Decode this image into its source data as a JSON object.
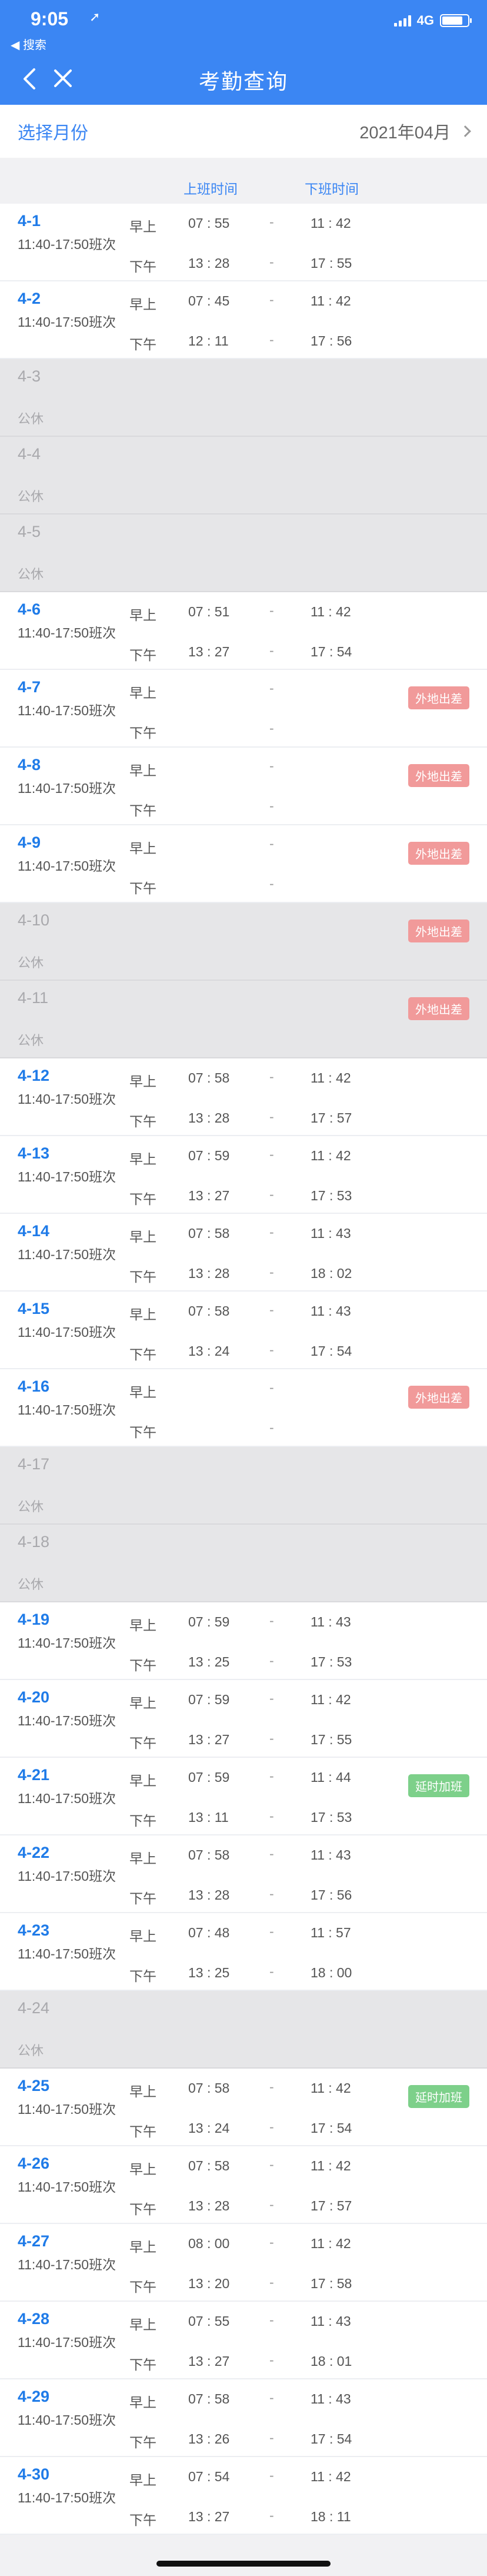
{
  "status_bar": {
    "time": "9:05",
    "back_app": "◀ 搜索",
    "network": "4G",
    "battery_level": 0.8
  },
  "nav": {
    "title": "考勤查询"
  },
  "month_bar": {
    "label": "选择月份",
    "value": "2021年04月"
  },
  "columns": {
    "clock_in": "上班时间",
    "clock_out": "下班时间"
  },
  "labels": {
    "am": "早上",
    "pm": "下午",
    "dash": "-",
    "rest": "公休"
  },
  "colors": {
    "brand": "#3b86f3",
    "business_trip": "#f19a9a",
    "overtime": "#7dd08a"
  },
  "days": [
    {
      "date": "4-1",
      "shift": "11:40-17:50班次",
      "am_in": "07 : 55",
      "am_out": "11 : 42",
      "pm_in": "13 : 28",
      "pm_out": "17 : 55"
    },
    {
      "date": "4-2",
      "shift": "11:40-17:50班次",
      "am_in": "07 : 45",
      "am_out": "11 : 42",
      "pm_in": "12 : 11",
      "pm_out": "17 : 56"
    },
    {
      "date": "4-3",
      "rest": true
    },
    {
      "date": "4-4",
      "rest": true
    },
    {
      "date": "4-5",
      "rest": true
    },
    {
      "date": "4-6",
      "shift": "11:40-17:50班次",
      "am_in": "07 : 51",
      "am_out": "11 : 42",
      "pm_in": "13 : 27",
      "pm_out": "17 : 54"
    },
    {
      "date": "4-7",
      "shift": "11:40-17:50班次",
      "am_in": "",
      "am_out": "",
      "pm_in": "",
      "pm_out": "",
      "tag": "外地出差",
      "tag_type": "trip"
    },
    {
      "date": "4-8",
      "shift": "11:40-17:50班次",
      "am_in": "",
      "am_out": "",
      "pm_in": "",
      "pm_out": "",
      "tag": "外地出差",
      "tag_type": "trip"
    },
    {
      "date": "4-9",
      "shift": "11:40-17:50班次",
      "am_in": "",
      "am_out": "",
      "pm_in": "",
      "pm_out": "",
      "tag": "外地出差",
      "tag_type": "trip"
    },
    {
      "date": "4-10",
      "rest": true,
      "tag": "外地出差",
      "tag_type": "trip"
    },
    {
      "date": "4-11",
      "rest": true,
      "tag": "外地出差",
      "tag_type": "trip"
    },
    {
      "date": "4-12",
      "shift": "11:40-17:50班次",
      "am_in": "07 : 58",
      "am_out": "11 : 42",
      "pm_in": "13 : 28",
      "pm_out": "17 : 57"
    },
    {
      "date": "4-13",
      "shift": "11:40-17:50班次",
      "am_in": "07 : 59",
      "am_out": "11 : 42",
      "pm_in": "13 : 27",
      "pm_out": "17 : 53"
    },
    {
      "date": "4-14",
      "shift": "11:40-17:50班次",
      "am_in": "07 : 58",
      "am_out": "11 : 43",
      "pm_in": "13 : 28",
      "pm_out": "18 : 02"
    },
    {
      "date": "4-15",
      "shift": "11:40-17:50班次",
      "am_in": "07 : 58",
      "am_out": "11 : 43",
      "pm_in": "13 : 24",
      "pm_out": "17 : 54"
    },
    {
      "date": "4-16",
      "shift": "11:40-17:50班次",
      "am_in": "",
      "am_out": "",
      "pm_in": "",
      "pm_out": "",
      "tag": "外地出差",
      "tag_type": "trip"
    },
    {
      "date": "4-17",
      "rest": true
    },
    {
      "date": "4-18",
      "rest": true
    },
    {
      "date": "4-19",
      "shift": "11:40-17:50班次",
      "am_in": "07 : 59",
      "am_out": "11 : 43",
      "pm_in": "13 : 25",
      "pm_out": "17 : 53"
    },
    {
      "date": "4-20",
      "shift": "11:40-17:50班次",
      "am_in": "07 : 59",
      "am_out": "11 : 42",
      "pm_in": "13 : 27",
      "pm_out": "17 : 55"
    },
    {
      "date": "4-21",
      "shift": "11:40-17:50班次",
      "am_in": "07 : 59",
      "am_out": "11 : 44",
      "pm_in": "13 : 11",
      "pm_out": "17 : 53",
      "tag": "延时加班",
      "tag_type": "overtime"
    },
    {
      "date": "4-22",
      "shift": "11:40-17:50班次",
      "am_in": "07 : 58",
      "am_out": "11 : 43",
      "pm_in": "13 : 28",
      "pm_out": "17 : 56"
    },
    {
      "date": "4-23",
      "shift": "11:40-17:50班次",
      "am_in": "07 : 48",
      "am_out": "11 : 57",
      "pm_in": "13 : 25",
      "pm_out": "18 : 00"
    },
    {
      "date": "4-24",
      "rest": true
    },
    {
      "date": "4-25",
      "shift": "11:40-17:50班次",
      "am_in": "07 : 58",
      "am_out": "11 : 42",
      "pm_in": "13 : 24",
      "pm_out": "17 : 54",
      "tag": "延时加班",
      "tag_type": "overtime"
    },
    {
      "date": "4-26",
      "shift": "11:40-17:50班次",
      "am_in": "07 : 58",
      "am_out": "11 : 42",
      "pm_in": "13 : 28",
      "pm_out": "17 : 57"
    },
    {
      "date": "4-27",
      "shift": "11:40-17:50班次",
      "am_in": "08 : 00",
      "am_out": "11 : 42",
      "pm_in": "13 : 20",
      "pm_out": "17 : 58"
    },
    {
      "date": "4-28",
      "shift": "11:40-17:50班次",
      "am_in": "07 : 55",
      "am_out": "11 : 43",
      "pm_in": "13 : 27",
      "pm_out": "18 : 01"
    },
    {
      "date": "4-29",
      "shift": "11:40-17:50班次",
      "am_in": "07 : 58",
      "am_out": "11 : 43",
      "pm_in": "13 : 26",
      "pm_out": "17 : 54"
    },
    {
      "date": "4-30",
      "shift": "11:40-17:50班次",
      "am_in": "07 : 54",
      "am_out": "11 : 42",
      "pm_in": "13 : 27",
      "pm_out": "18 : 11"
    }
  ]
}
